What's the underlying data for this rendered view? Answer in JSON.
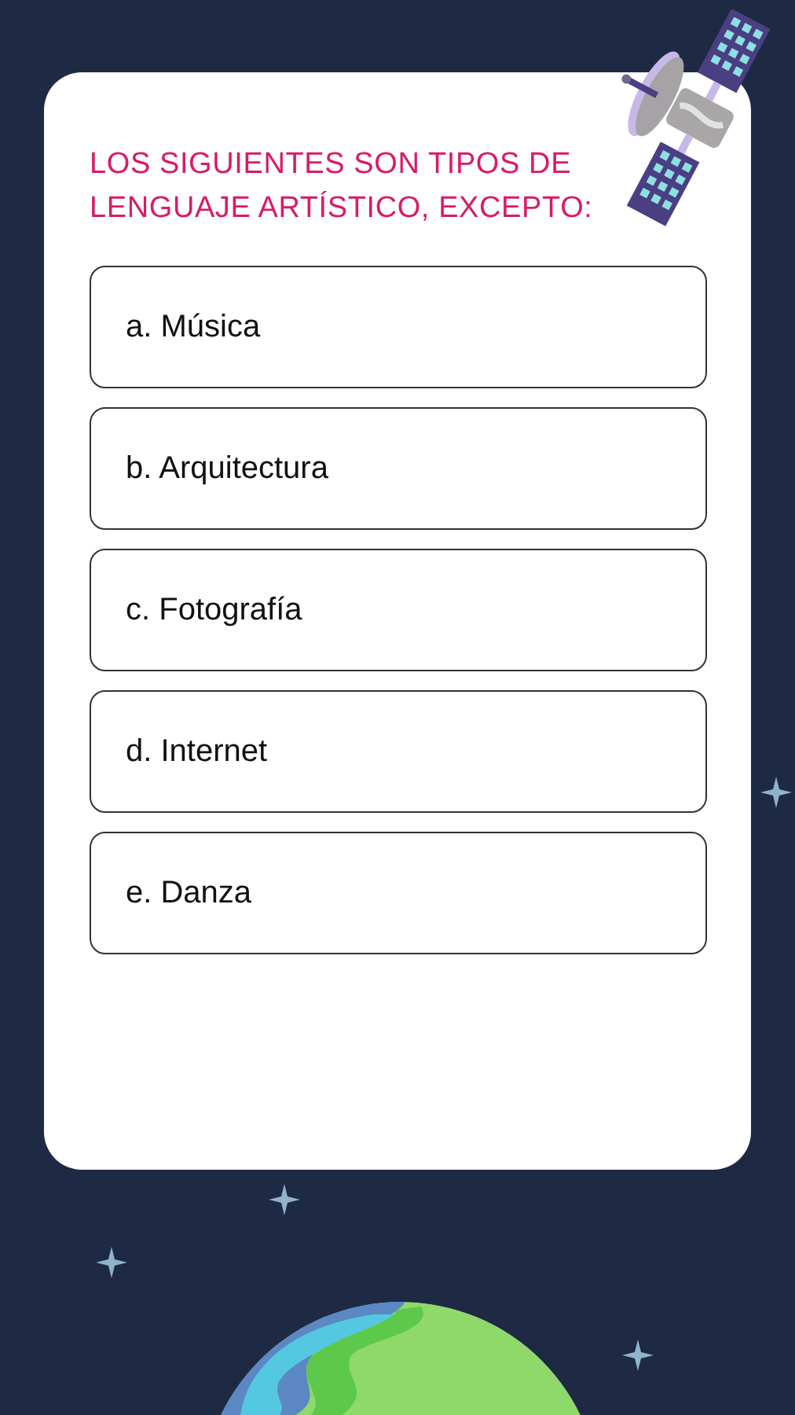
{
  "question": "LOS SIGUIENTES SON TIPOS DE LENGUAJE ARTÍSTICO, EXCEPTO:",
  "options": [
    {
      "label": "a. Música"
    },
    {
      "label": "b. Arquitectura"
    },
    {
      "label": "c. Fotografía"
    },
    {
      "label": "d. Internet"
    },
    {
      "label": "e. Danza"
    }
  ]
}
